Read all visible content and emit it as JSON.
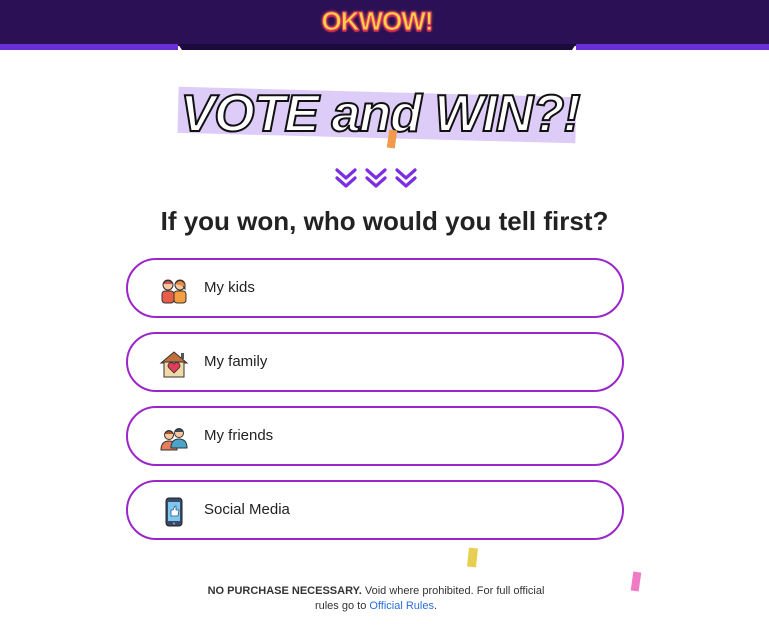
{
  "header": {
    "logo_text": "OKWOW!"
  },
  "hero": {
    "title": "VOTE and WIN?!"
  },
  "question": "If you won, who would you tell first?",
  "options": [
    {
      "label": "My kids",
      "icon": "kids-icon"
    },
    {
      "label": "My family",
      "icon": "house-heart-icon"
    },
    {
      "label": "My friends",
      "icon": "friends-icon"
    },
    {
      "label": "Social Media",
      "icon": "phone-like-icon"
    }
  ],
  "footer": {
    "bold": "NO PURCHASE NECESSARY.",
    "text": " Void where prohibited. For full official rules go to ",
    "link_text": "Official Rules",
    "end": "."
  },
  "colors": {
    "header_bg": "#2b1055",
    "accent_purple": "#9b26c9",
    "chevron_purple": "#7b2fe0",
    "highlight": "#d9c5f7",
    "link": "#2a6fdb"
  }
}
